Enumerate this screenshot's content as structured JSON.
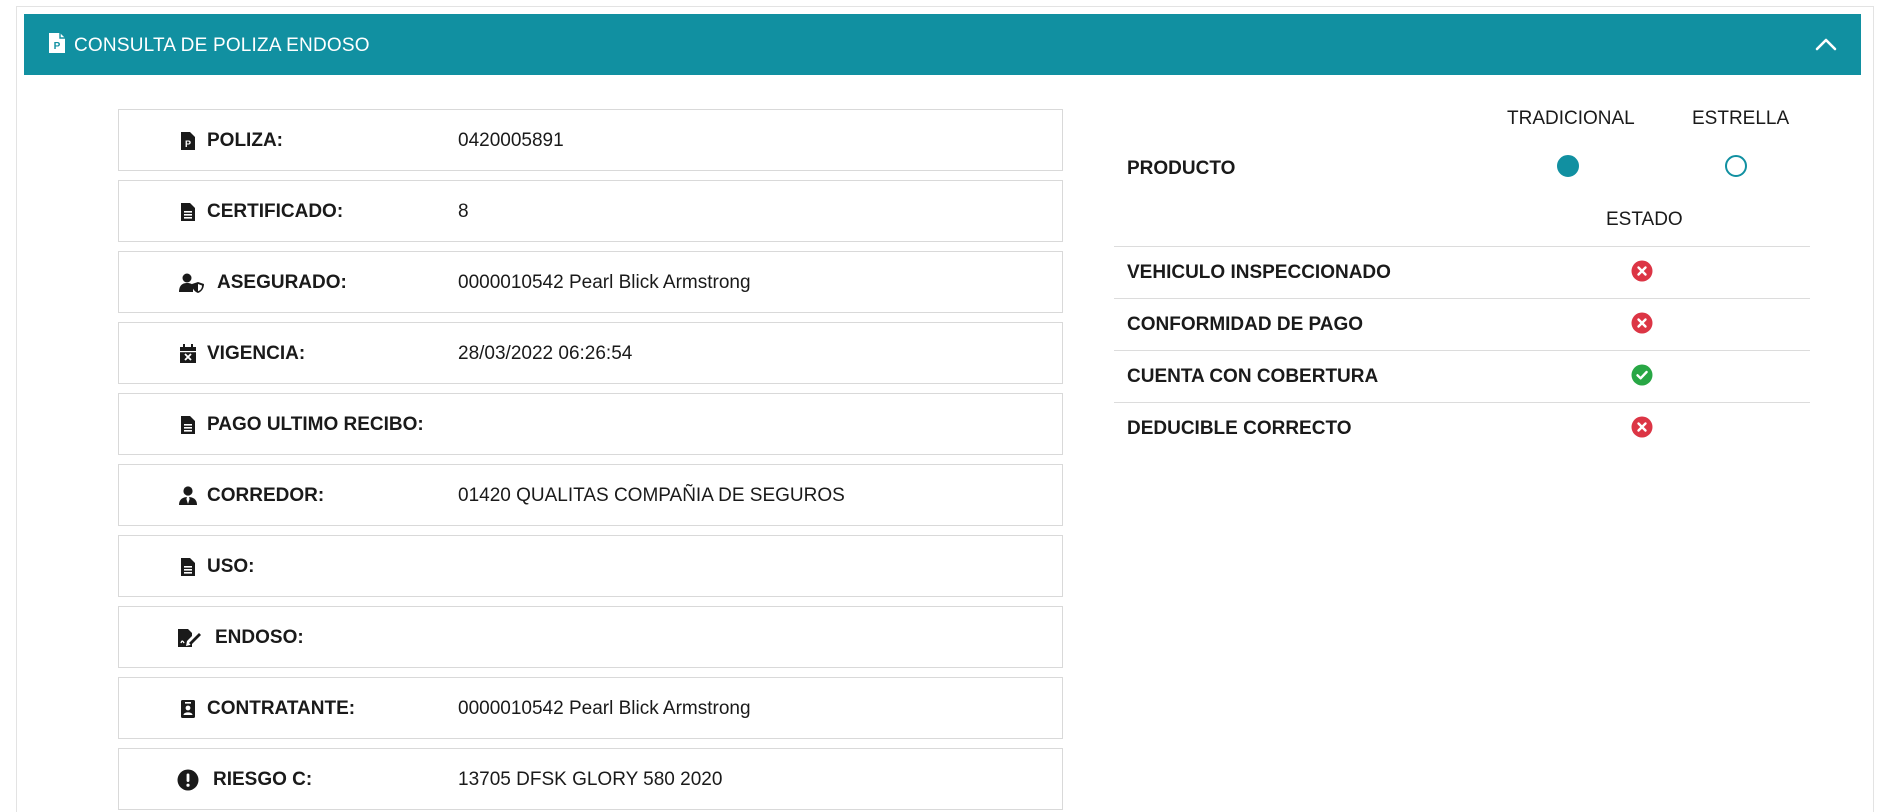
{
  "header": {
    "title": "CONSULTA DE POLIZA ENDOSO",
    "icon": "file-p-icon",
    "collapse_icon": "chevron-up-icon",
    "color": "#1190a1"
  },
  "fields": [
    {
      "label": "POLIZA:",
      "value": "0420005891",
      "icon": "file-p-icon"
    },
    {
      "label": "CERTIFICADO:",
      "value": "8",
      "icon": "file-text-icon"
    },
    {
      "label": "ASEGURADO:",
      "value": "0000010542 Pearl Blick Armstrong",
      "icon": "user-shield-icon"
    },
    {
      "label": "VIGENCIA:",
      "value": "28/03/2022 06:26:54",
      "icon": "calendar-x-icon"
    },
    {
      "label": "PAGO ULTIMO RECIBO:",
      "value": "",
      "icon": "file-text-icon"
    },
    {
      "label": "CORREDOR:",
      "value": "01420 QUALITAS COMPAÑIA DE SEGUROS",
      "icon": "user-tie-icon"
    },
    {
      "label": "USO:",
      "value": "",
      "icon": "file-text-icon"
    },
    {
      "label": "ENDOSO:",
      "value": "",
      "icon": "file-signature-icon"
    },
    {
      "label": "CONTRATANTE:",
      "value": "0000010542 Pearl Blick Armstrong",
      "icon": "id-badge-icon"
    },
    {
      "label": "RIESGO C:",
      "value": "13705 DFSK GLORY 580 2020",
      "icon": "exclamation-circle-icon"
    }
  ],
  "product": {
    "label": "PRODUCTO",
    "options": [
      {
        "label": "TRADICIONAL",
        "selected": true
      },
      {
        "label": "ESTRELLA",
        "selected": false
      }
    ]
  },
  "status": {
    "header": "ESTADO",
    "rows": [
      {
        "label": "VEHICULO INSPECCIONADO",
        "ok": false,
        "icon": "x-circle-icon"
      },
      {
        "label": "CONFORMIDAD DE PAGO",
        "ok": false,
        "icon": "x-circle-icon"
      },
      {
        "label": "CUENTA CON COBERTURA",
        "ok": true,
        "icon": "check-circle-icon"
      },
      {
        "label": "DEDUCIBLE CORRECTO",
        "ok": false,
        "icon": "x-circle-icon"
      }
    ],
    "colors": {
      "ok": "#28a745",
      "fail": "#dc3545"
    }
  }
}
